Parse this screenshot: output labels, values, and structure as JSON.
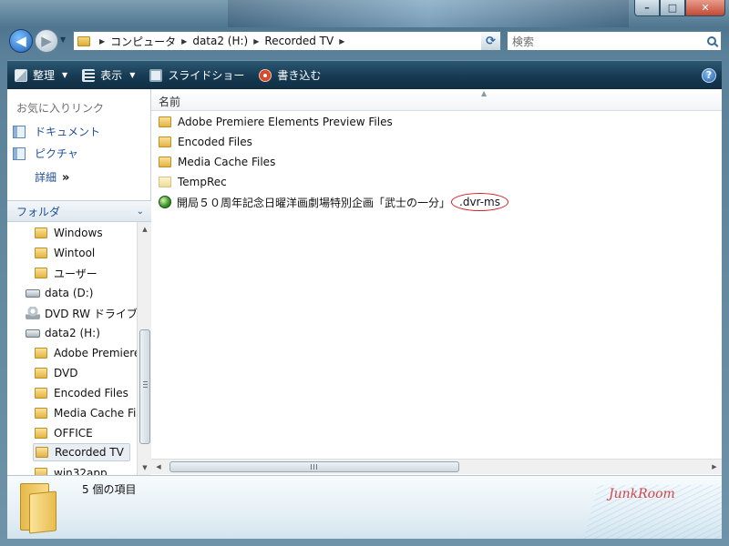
{
  "address": {
    "breadcrumbs": [
      "コンピュータ",
      "data2 (H:)",
      "Recorded TV"
    ]
  },
  "search": {
    "placeholder": "検索"
  },
  "toolbar": {
    "organize": "整理",
    "view": "表示",
    "slideshow": "スライドショー",
    "burn": "書き込む"
  },
  "favorites": {
    "header": "お気に入りリンク",
    "items": [
      {
        "label": "ドキュメント",
        "icon": "documents-icon"
      },
      {
        "label": "ピクチャ",
        "icon": "pictures-icon"
      }
    ],
    "more": "詳細"
  },
  "folders": {
    "header": "フォルダ",
    "tree": [
      {
        "label": "Windows",
        "type": "folder"
      },
      {
        "label": "Wintool",
        "type": "folder"
      },
      {
        "label": "ユーザー",
        "type": "folder"
      },
      {
        "label": "data (D:)",
        "type": "drive"
      },
      {
        "label": "DVD RW ドライブ",
        "type": "dvd"
      },
      {
        "label": "data2 (H:)",
        "type": "drive"
      },
      {
        "label": "Adobe Premiere",
        "type": "folder"
      },
      {
        "label": "DVD",
        "type": "folder"
      },
      {
        "label": "Encoded Files",
        "type": "folder"
      },
      {
        "label": "Media Cache Fi",
        "type": "folder"
      },
      {
        "label": "OFFICE",
        "type": "folder"
      },
      {
        "label": "Recorded TV",
        "type": "folder",
        "selected": true
      },
      {
        "label": "win32app",
        "type": "folder"
      }
    ]
  },
  "filelist": {
    "column_name": "名前",
    "files": [
      {
        "name": "Adobe Premiere Elements Preview Files",
        "type": "folder"
      },
      {
        "name": "Encoded Files",
        "type": "folder"
      },
      {
        "name": "Media Cache Files",
        "type": "folder"
      },
      {
        "name": "TempRec",
        "type": "folder-pale"
      },
      {
        "name": "開局５０周年記念日曜洋画劇場特別企画「武士の一分」",
        "ext": ".dvr-ms",
        "type": "dvr"
      }
    ]
  },
  "details": {
    "count": "5 個の項目",
    "brand": "JunkRoom"
  }
}
